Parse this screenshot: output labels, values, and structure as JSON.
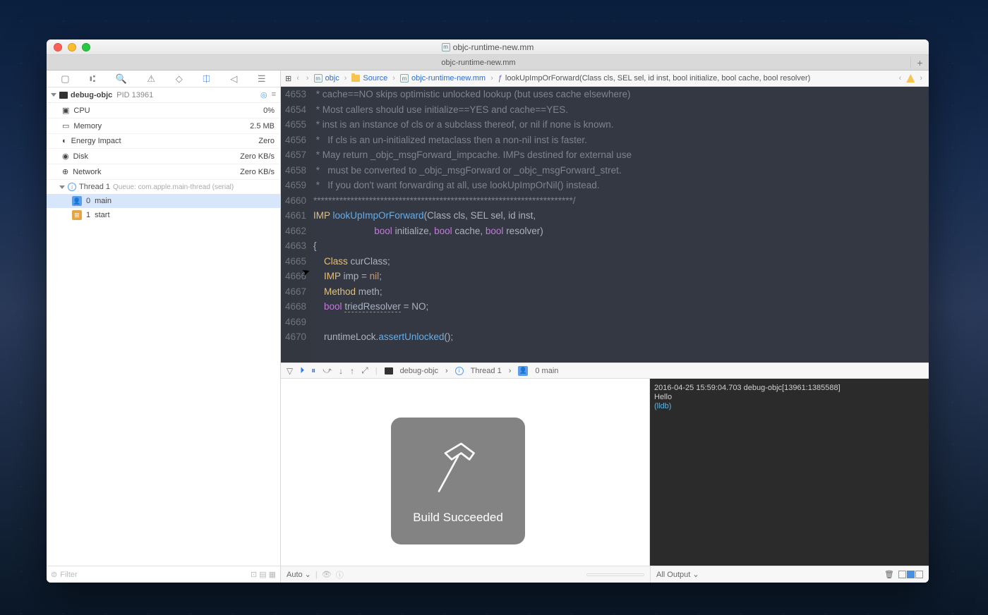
{
  "titlebar": {
    "filename": "objc-runtime-new.mm"
  },
  "tab": {
    "label": "objc-runtime-new.mm",
    "addLabel": "+"
  },
  "sidebar": {
    "processName": "debug-objc",
    "pidLabel": "PID 13961",
    "metrics": [
      {
        "label": "CPU",
        "value": "0%"
      },
      {
        "label": "Memory",
        "value": "2.5 MB"
      },
      {
        "label": "Energy Impact",
        "value": "Zero"
      },
      {
        "label": "Disk",
        "value": "Zero KB/s"
      },
      {
        "label": "Network",
        "value": "Zero KB/s"
      }
    ],
    "thread": {
      "label": "Thread 1",
      "queue": "Queue: com.apple.main-thread (serial)"
    },
    "frames": [
      {
        "idx": "0",
        "name": "main"
      },
      {
        "idx": "1",
        "name": "start"
      }
    ],
    "filterPlaceholder": "Filter"
  },
  "jumpbar": {
    "project": "objc",
    "folder": "Source",
    "file": "objc-runtime-new.mm",
    "symbol": "lookUpImpOrForward(Class cls, SEL sel, id inst, bool initialize, bool cache, bool resolver)"
  },
  "code": {
    "startLine": 4653,
    "lines": [
      " * cache==NO skips optimistic unlocked lookup (but uses cache elsewhere)",
      " * Most callers should use initialize==YES and cache==YES.",
      " * inst is an instance of cls or a subclass thereof, or nil if none is known.",
      " *   If cls is an un-initialized metaclass then a non-nil inst is faster.",
      " * May return _objc_msgForward_impcache. IMPs destined for external use",
      " *   must be converted to _objc_msgForward or _objc_msgForward_stret.",
      " *   If you don't want forwarding at all, use lookUpImpOrNil() instead.",
      "**********************************************************************/"
    ],
    "sig1_ret": "IMP",
    "sig1_name": "lookUpImpOrForward",
    "sig1_params": "(Class cls, SEL sel, id inst,",
    "sig2": "                       bool initialize, bool cache, bool resolver)",
    "brace_open": "{",
    "l_class": "    Class curClass;",
    "l_imp": "    IMP imp = nil;",
    "l_meth": "    Method meth;",
    "l_bool_kw": "bool",
    "l_bool_var": "triedResolver",
    "l_bool_rest": " = NO;",
    "l_blank": "",
    "l_runtime": "    runtimeLock.assertUnlocked();"
  },
  "dbgbar": {
    "processName": "debug-objc",
    "thread": "Thread 1",
    "frame": "0 main"
  },
  "console": {
    "line1": "2016-04-25 15:59:04.703 debug-objc[13961:1385588]",
    "line2": "Hello",
    "prompt": "(lldb)"
  },
  "bottombar": {
    "leftLabel": "Auto ⌄",
    "rightLabel": "All Output ⌄"
  },
  "toast": {
    "message": "Build Succeeded"
  }
}
